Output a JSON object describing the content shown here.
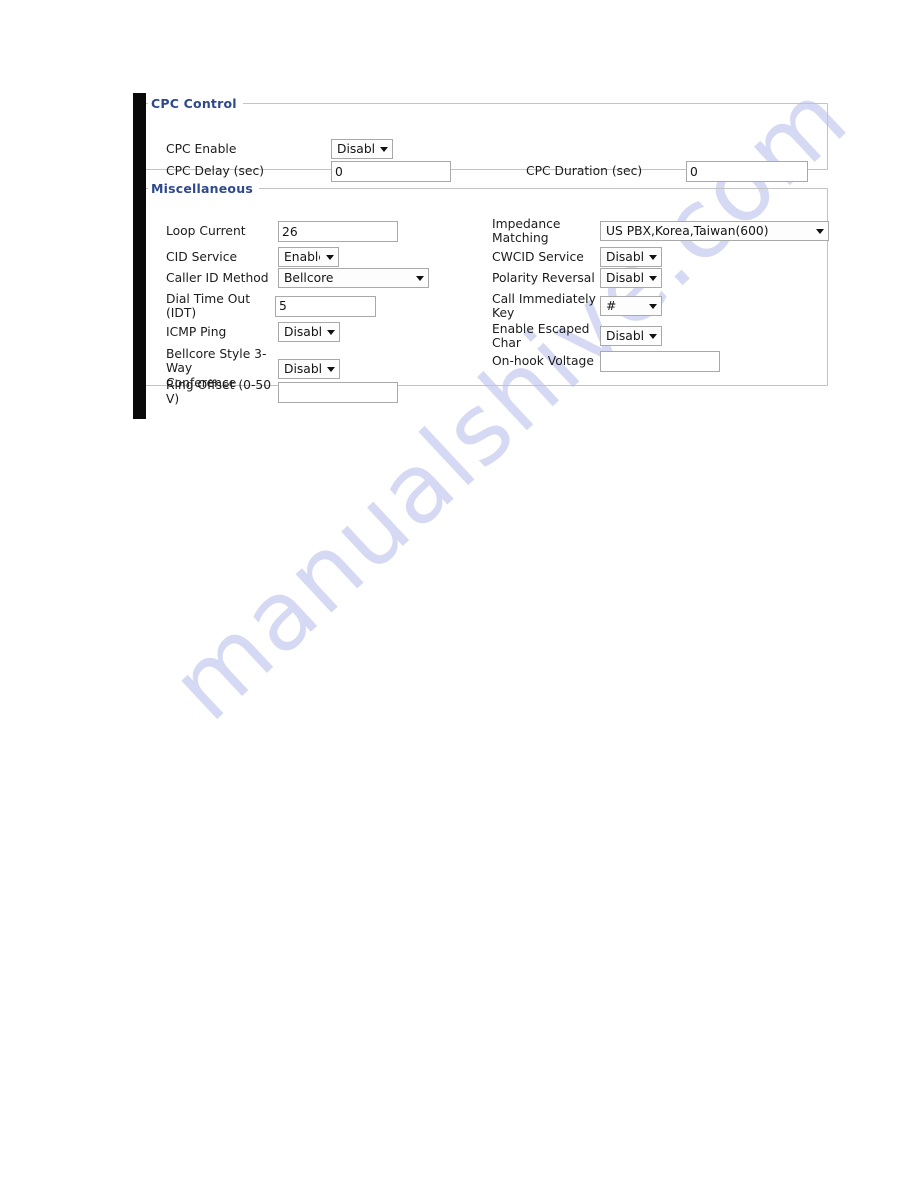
{
  "page": {
    "watermark": "manualshive.com"
  },
  "cpc_control": {
    "legend": "CPC Control",
    "fields": {
      "cpc_enable": {
        "label": "CPC Enable",
        "type": "select",
        "value": "Disable"
      },
      "cpc_delay": {
        "label": "CPC Delay (sec)",
        "type": "text",
        "value": "0"
      },
      "cpc_duration": {
        "label": "CPC Duration (sec)",
        "type": "text",
        "value": "0"
      }
    }
  },
  "miscellaneous": {
    "legend": "Miscellaneous",
    "left_fields": {
      "loop_current": {
        "label": "Loop Current",
        "type": "text",
        "value": "26"
      },
      "cid_service": {
        "label": "CID Service",
        "type": "select",
        "value": "Enable"
      },
      "caller_id_method": {
        "label": "Caller ID Method",
        "type": "select",
        "value": "Bellcore"
      },
      "dial_time_out": {
        "label": "Dial Time Out (IDT)",
        "type": "text",
        "value": "5"
      },
      "icmp_ping": {
        "label": "ICMP Ping",
        "type": "select",
        "value": "Disable"
      },
      "bellcore_3way": {
        "label": "Bellcore Style 3-Way\nConference",
        "type": "select",
        "value": "Disable"
      },
      "ring_offset": {
        "label": "Ring Offset (0-50 V)",
        "type": "text",
        "value": ""
      }
    },
    "right_fields": {
      "impedance_matching": {
        "label": "Impedance\nMatching",
        "type": "select",
        "value": "US PBX,Korea,Taiwan(600)"
      },
      "cwcid_service": {
        "label": "CWCID Service",
        "type": "select",
        "value": "Disable"
      },
      "polarity_reversal": {
        "label": "Polarity Reversal",
        "type": "select",
        "value": "Disable"
      },
      "call_immediately_key": {
        "label": "Call Immediately\nKey",
        "type": "select",
        "value": "#"
      },
      "enable_escaped_char": {
        "label": "Enable Escaped\nChar",
        "type": "select",
        "value": "Disable"
      },
      "onhook_voltage": {
        "label": "On-hook Voltage",
        "type": "text",
        "value": ""
      }
    }
  },
  "colors": {
    "legend_blue": "#2f4a8c",
    "watermark": "#c9cdef",
    "border": "#c3c3c3",
    "control_border": "#a9a9a9"
  }
}
